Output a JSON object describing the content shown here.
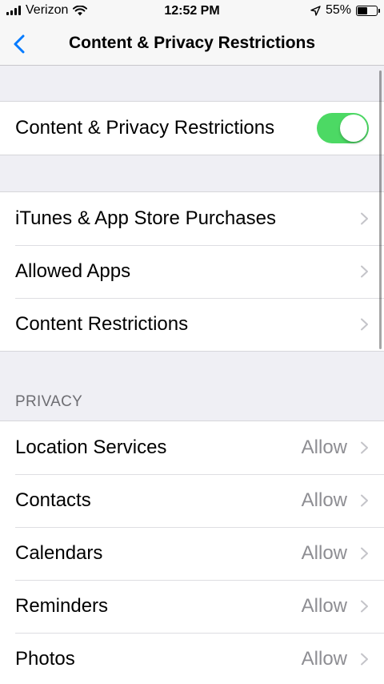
{
  "status_bar": {
    "carrier": "Verizon",
    "time": "12:52 PM",
    "battery_percent": "55%",
    "battery_level": 0.55,
    "icons": [
      "signal-bars-icon",
      "wifi-icon",
      "location-arrow-icon",
      "battery-icon"
    ]
  },
  "nav": {
    "title": "Content & Privacy Restrictions",
    "back_icon": "chevron-left-icon"
  },
  "colors": {
    "accent": "#007aff",
    "toggle_on": "#4cd964",
    "secondary_text": "#8e8e93",
    "background": "#efeff4"
  },
  "main_toggle": {
    "label": "Content & Privacy Restrictions",
    "on": true
  },
  "restrictions": {
    "items": [
      {
        "label": "iTunes & App Store Purchases"
      },
      {
        "label": "Allowed Apps"
      },
      {
        "label": "Content Restrictions"
      }
    ]
  },
  "privacy": {
    "header": "PRIVACY",
    "items": [
      {
        "label": "Location Services",
        "value": "Allow"
      },
      {
        "label": "Contacts",
        "value": "Allow"
      },
      {
        "label": "Calendars",
        "value": "Allow"
      },
      {
        "label": "Reminders",
        "value": "Allow"
      },
      {
        "label": "Photos",
        "value": "Allow"
      }
    ]
  }
}
